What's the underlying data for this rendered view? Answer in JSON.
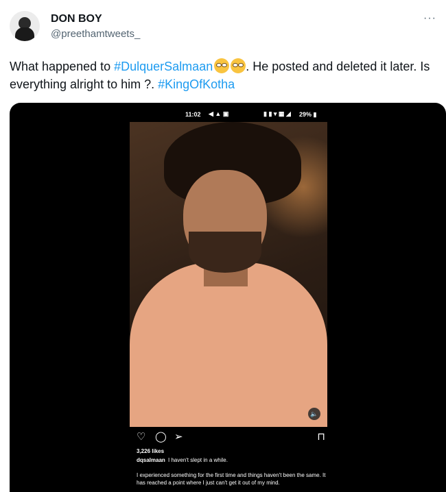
{
  "tweet": {
    "display_name": "DON BOY",
    "handle": "@preethamtweets_",
    "more_label": "···",
    "text_part1": "What happened to ",
    "hashtag1": "#DulquerSalmaan",
    "emoji_name": "face-with-rolling-eyes",
    "text_part2": ". He posted and deleted it later. Is everything alright to him ?. ",
    "hashtag2": "#KingOfKotha",
    "hashtag_color": "#1d9bf0"
  },
  "screenshot": {
    "status_time": "11:02",
    "status_left_icons": "◀ ▲ ▣",
    "status_right_icons": "▮ ▮ ▾ ▦ ◢",
    "battery": "29% ▮",
    "likes": "3,226 likes",
    "caption_user": "dqsalmaan",
    "caption_text": "I haven't slept in a while.",
    "caption_body": "I experienced something for the first time and things haven't been the same. It has reached a point where I just can't get it out of my mind."
  },
  "icons": {
    "like": "♡",
    "comment": "◯",
    "share": "➢",
    "save": "⊓",
    "mute": "🔈"
  }
}
